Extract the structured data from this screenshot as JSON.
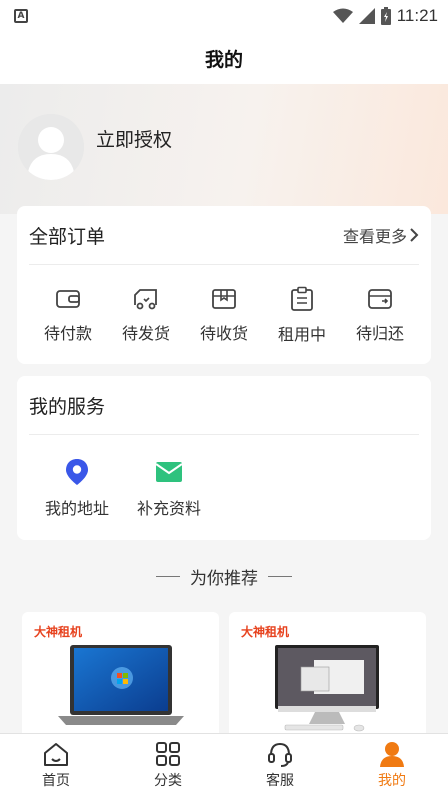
{
  "status_bar": {
    "time": "11:21",
    "notification_icon": "a-icon"
  },
  "nav": {
    "title": "我的"
  },
  "profile": {
    "name": "立即授权"
  },
  "orders": {
    "title": "全部订单",
    "more": "查看更多",
    "items": [
      {
        "label": "待付款",
        "icon": "wallet-icon"
      },
      {
        "label": "待发货",
        "icon": "truck-icon"
      },
      {
        "label": "待收货",
        "icon": "box-icon"
      },
      {
        "label": "租用中",
        "icon": "clipboard-icon"
      },
      {
        "label": "待归还",
        "icon": "return-icon"
      }
    ]
  },
  "services": {
    "title": "我的服务",
    "items": [
      {
        "label": "我的地址",
        "icon": "location-pin-icon",
        "color": "#3a57e8"
      },
      {
        "label": "补充资料",
        "icon": "mail-icon",
        "color": "#2ec27e"
      }
    ]
  },
  "recommend": {
    "title": "为你推荐",
    "products": [
      {
        "brand": "大神租机",
        "image": "laptop"
      },
      {
        "brand": "大神租机",
        "image": "all-in-one-pc"
      }
    ]
  },
  "tabbar": {
    "tabs": [
      {
        "label": "首页",
        "icon": "home-icon",
        "active": false
      },
      {
        "label": "分类",
        "icon": "category-icon",
        "active": false
      },
      {
        "label": "客服",
        "icon": "headset-icon",
        "active": false
      },
      {
        "label": "我的",
        "icon": "user-icon",
        "active": true
      }
    ],
    "accent": "#f07a12"
  }
}
